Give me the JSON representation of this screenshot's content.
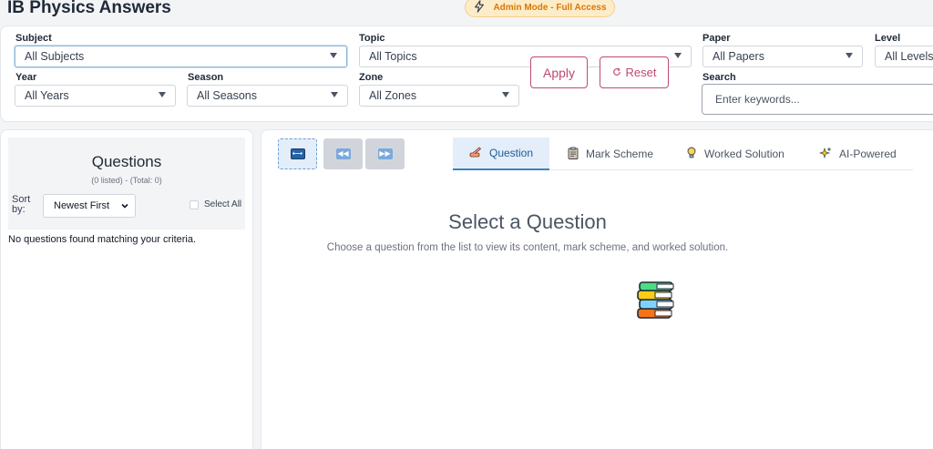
{
  "app": {
    "title": "IB Physics Answers"
  },
  "admin_badge": {
    "label": "Admin Mode - Full Access"
  },
  "filters": {
    "subject": {
      "label": "Subject",
      "value": "All Subjects"
    },
    "topic": {
      "label": "Topic",
      "value": "All Topics"
    },
    "paper": {
      "label": "Paper",
      "value": "All Papers"
    },
    "level": {
      "label": "Level",
      "value": "All Levels"
    },
    "year": {
      "label": "Year",
      "value": "All Years"
    },
    "season": {
      "label": "Season",
      "value": "All Seasons"
    },
    "zone": {
      "label": "Zone",
      "value": "All Zones"
    },
    "apply_label": "Apply",
    "reset_label": "Reset",
    "search": {
      "label": "Search",
      "placeholder": "Enter keywords..."
    }
  },
  "questions_panel": {
    "title": "Questions",
    "count_text": "(0 listed) - (Total: 0)",
    "sort_label": "Sort by:",
    "sort_value": "Newest First",
    "select_all_label": "Select All",
    "empty_message": "No questions found matching your criteria."
  },
  "tabs": [
    {
      "label": "Question",
      "icon": "hand-writing-icon",
      "active": true
    },
    {
      "label": "Mark Scheme",
      "icon": "clipboard-icon",
      "active": false
    },
    {
      "label": "Worked Solution",
      "icon": "lightbulb-icon",
      "active": false
    },
    {
      "label": "AI-Powered",
      "icon": "sparkles-icon",
      "active": false
    }
  ],
  "empty_state": {
    "icon": "books-icon",
    "title": "Select a Question",
    "subtitle": "Choose a question from the list to view its content, mark scheme, and worked solution."
  },
  "colors": {
    "accent": "#be4a6e",
    "tab_active_bg": "#e3eefa",
    "tab_active_text": "#1e5a96",
    "badge_bg": "#fdecc8",
    "badge_text": "#d97706"
  }
}
